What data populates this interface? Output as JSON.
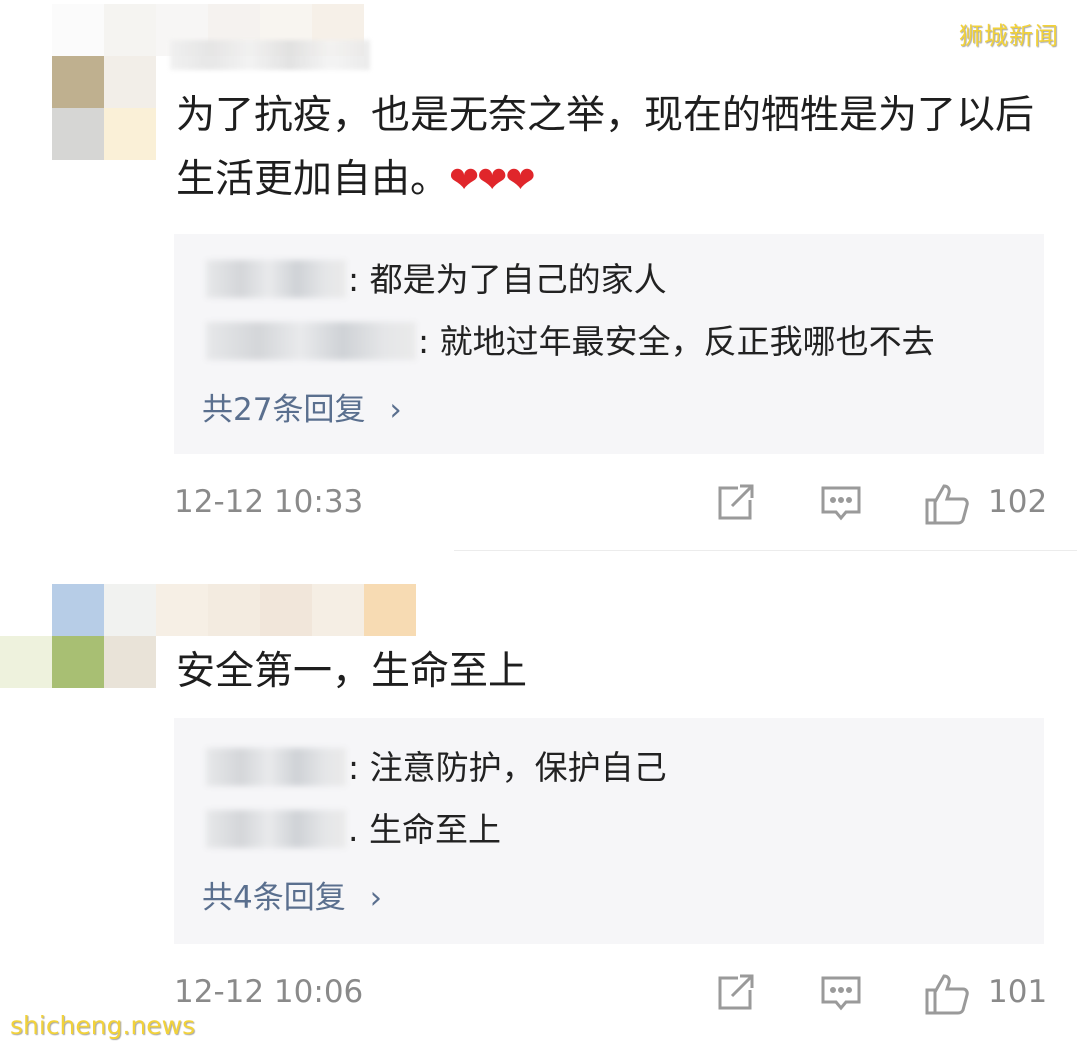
{
  "watermarks": {
    "top_right": "狮城新闻",
    "bottom_left": "shicheng.news"
  },
  "comments": [
    {
      "text": "为了抗疫，也是无奈之举，现在的牺牲是为了以后生活更加自由。",
      "emoji": "❤❤❤",
      "replies": [
        {
          "text": ": 都是为了自己的家人"
        },
        {
          "text": ": 就地过年最安全，反正我哪也不去"
        }
      ],
      "more_replies": "共27条回复",
      "more_replies_chevron": "›",
      "timestamp": "12-12 10:33",
      "likes": "102",
      "icons": [
        "share-icon",
        "comment-icon",
        "like-icon"
      ]
    },
    {
      "text": "安全第一，生命至上",
      "replies": [
        {
          "text": ": 注意防护，保护自己"
        },
        {
          "text": ". 生命至上"
        }
      ],
      "more_replies": "共4条回复",
      "more_replies_chevron": "›",
      "timestamp": "12-12 10:06",
      "likes": "101",
      "icons": [
        "share-icon",
        "comment-icon",
        "like-icon"
      ]
    }
  ],
  "colors": {
    "link": "#5a6f8e",
    "meta": "#8a8a8a",
    "reply_bg": "#f6f6f8",
    "heart": "#e0262b",
    "watermark": "#f2d23a"
  }
}
